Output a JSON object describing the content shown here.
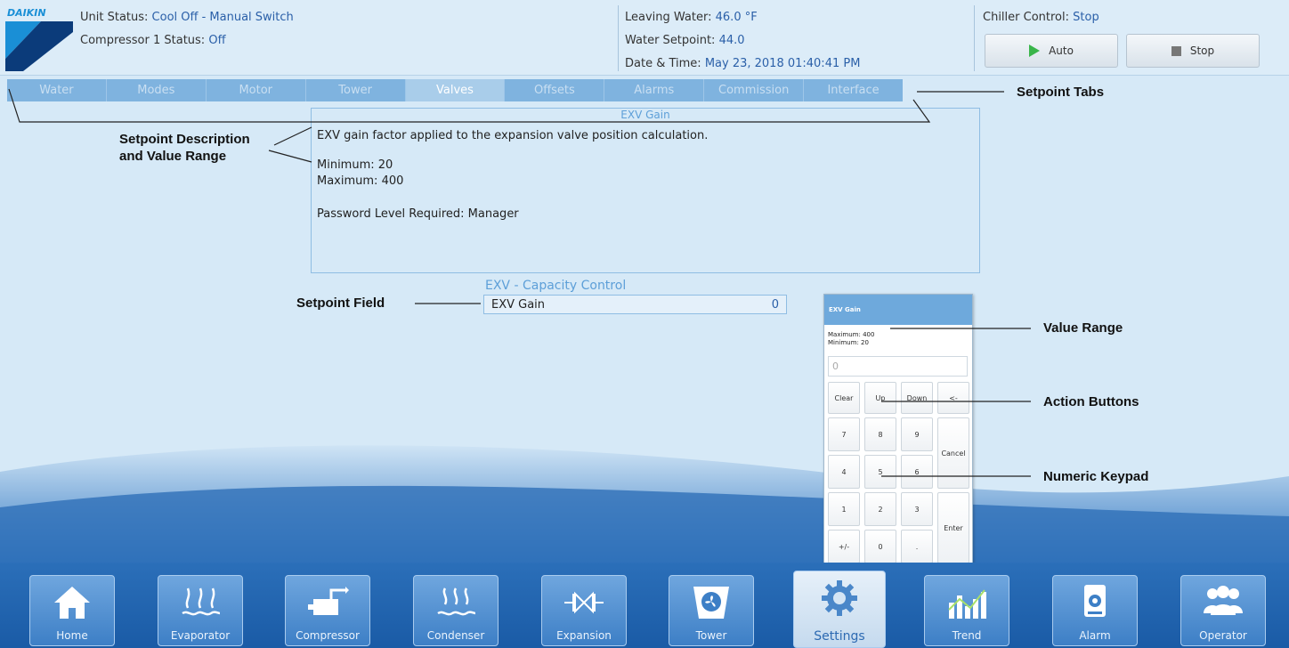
{
  "header": {
    "brand": "DAIKIN",
    "unit_status_label": "Unit Status:",
    "unit_status_value": "Cool Off - Manual Switch",
    "compressor_status_label": "Compressor 1 Status:",
    "compressor_status_value": "Off",
    "leaving_water_label": "Leaving Water:",
    "leaving_water_value": "46.0 °F",
    "water_setpoint_label": "Water Setpoint:",
    "water_setpoint_value": "44.0",
    "datetime_label": "Date & Time:",
    "datetime_value": "May 23, 2018  01:40:41 PM",
    "chiller_control_label": "Chiller Control:",
    "chiller_control_value": "Stop",
    "auto_label": "Auto",
    "stop_label": "Stop"
  },
  "tabs": [
    {
      "label": "Water"
    },
    {
      "label": "Modes"
    },
    {
      "label": "Motor"
    },
    {
      "label": "Tower"
    },
    {
      "label": "Valves",
      "active": true
    },
    {
      "label": "Offsets"
    },
    {
      "label": "Alarms"
    },
    {
      "label": "Commission"
    },
    {
      "label": "Interface"
    }
  ],
  "description": {
    "title": "EXV Gain",
    "text": "EXV gain factor applied to the expansion valve position calculation.",
    "minimum": "Minimum: 20",
    "maximum": "Maximum: 400",
    "password": "Password Level Required: Manager"
  },
  "setpoint": {
    "group_title": "EXV - Capacity Control",
    "name": "EXV Gain",
    "value": "0"
  },
  "keypad": {
    "title": "EXV Gain",
    "maximum": "Maximum: 400",
    "minimum": "Minimum: 20",
    "input_value": "0",
    "actions": [
      "Clear",
      "Up",
      "Down",
      "<-"
    ],
    "digits": [
      "7",
      "8",
      "9",
      "4",
      "5",
      "6",
      "1",
      "2",
      "3",
      "+/-",
      "0",
      "."
    ],
    "cancel": "Cancel",
    "enter": "Enter"
  },
  "annotations": {
    "setpoint_tabs": "Setpoint Tabs",
    "desc_line1": "Setpoint Description",
    "desc_line2": "and Value Range",
    "setpoint_field": "Setpoint Field",
    "value_range": "Value Range",
    "action_buttons": "Action Buttons",
    "numeric_keypad": "Numeric Keypad"
  },
  "nav": [
    {
      "label": "Home",
      "icon": "home-icon"
    },
    {
      "label": "Evaporator",
      "icon": "evaporator-icon"
    },
    {
      "label": "Compressor",
      "icon": "compressor-icon"
    },
    {
      "label": "Condenser",
      "icon": "condenser-icon"
    },
    {
      "label": "Expansion",
      "icon": "expansion-valve-icon"
    },
    {
      "label": "Tower",
      "icon": "tower-fan-icon"
    },
    {
      "label": "Settings",
      "icon": "gear-icon",
      "active": true
    },
    {
      "label": "Trend",
      "icon": "trend-chart-icon"
    },
    {
      "label": "Alarm",
      "icon": "alarm-icon"
    },
    {
      "label": "Operator",
      "icon": "operator-icon"
    }
  ],
  "colors": {
    "accent_blue": "#2a5fa8",
    "tab_active": "#a9cdea",
    "nav_active": "#e6f0f9",
    "play_green": "#39b54a"
  }
}
